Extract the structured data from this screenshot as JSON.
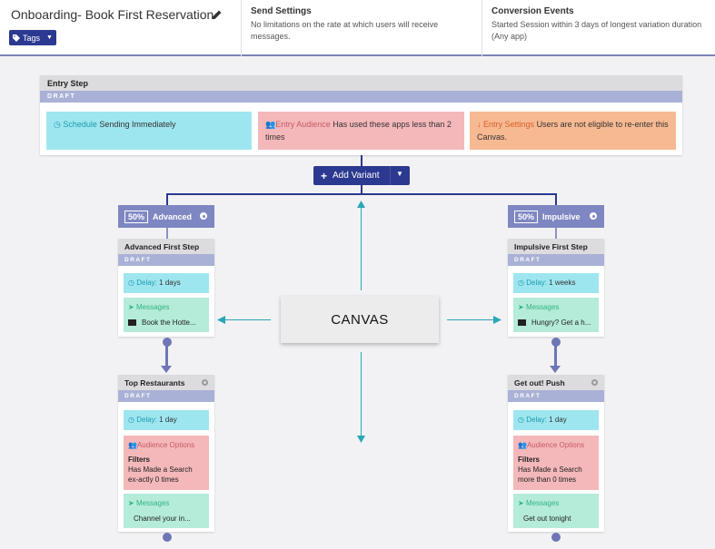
{
  "header": {
    "title": "Onboarding- Book First Reservation",
    "tags_label": "Tags",
    "send_settings": {
      "heading": "Send Settings",
      "text": "No limitations on the rate at which users will receive messages."
    },
    "conversion_events": {
      "heading": "Conversion Events",
      "text": "Started Session within 3 days of longest variation duration (Any app)"
    }
  },
  "entry_step": {
    "title": "Entry Step",
    "status": "DRAFT",
    "schedule_label": "Schedule",
    "schedule_value": "Sending Immediately",
    "audience_label": "Entry Audience",
    "audience_value": "Has used these apps less than 2 times",
    "settings_label": "Entry Settings",
    "settings_value": "Users are not eligible to re-enter this Canvas."
  },
  "add_variant_label": "Add Variant",
  "canvas_label": "CANVAS",
  "variants": [
    {
      "percent": "50%",
      "name": "Advanced",
      "steps": [
        {
          "title": "Advanced First Step",
          "status": "DRAFT",
          "delay_label": "Delay:",
          "delay_value": "1 days",
          "messages_label": "Messages",
          "message": "Book the Hotte..."
        },
        {
          "title": "Top Restaurants",
          "status": "DRAFT",
          "delay_label": "Delay:",
          "delay_value": "1 day",
          "audience_label": "Audience Options",
          "filters_label": "Filters",
          "filters_value": "Has Made a Search ex-actly 0 times",
          "messages_label": "Messages",
          "message": "Channel your in..."
        }
      ]
    },
    {
      "percent": "50%",
      "name": "Impulsive",
      "steps": [
        {
          "title": "Impulsive First Step",
          "status": "DRAFT",
          "delay_label": "Delay:",
          "delay_value": "1 weeks",
          "messages_label": "Messages",
          "message": "Hungry? Get a h..."
        },
        {
          "title": "Get out! Push",
          "status": "DRAFT",
          "delay_label": "Delay:",
          "delay_value": "1 day",
          "audience_label": "Audience Options",
          "filters_label": "Filters",
          "filters_value": "Has Made a Search more than 0 times",
          "messages_label": "Messages",
          "message": "Get out tonight"
        }
      ]
    }
  ],
  "icons": {
    "pencil": "pencil-icon",
    "tag": "tag-icon",
    "clock": "clock-icon",
    "users": "users-icon",
    "arrow_down": "arrow-down-icon",
    "paper_plane": "paper-plane-icon",
    "envelope": "envelope-icon",
    "apple": "apple-icon",
    "gear": "gear-icon"
  },
  "colors": {
    "brand": "#2b3990",
    "variant_header": "#7e87c2",
    "draft_bar": "#a9b1d6",
    "delay": "#9ee6ef",
    "messages": "#b5ebd9",
    "audience": "#f4b8ba",
    "settings": "#f7b992"
  }
}
